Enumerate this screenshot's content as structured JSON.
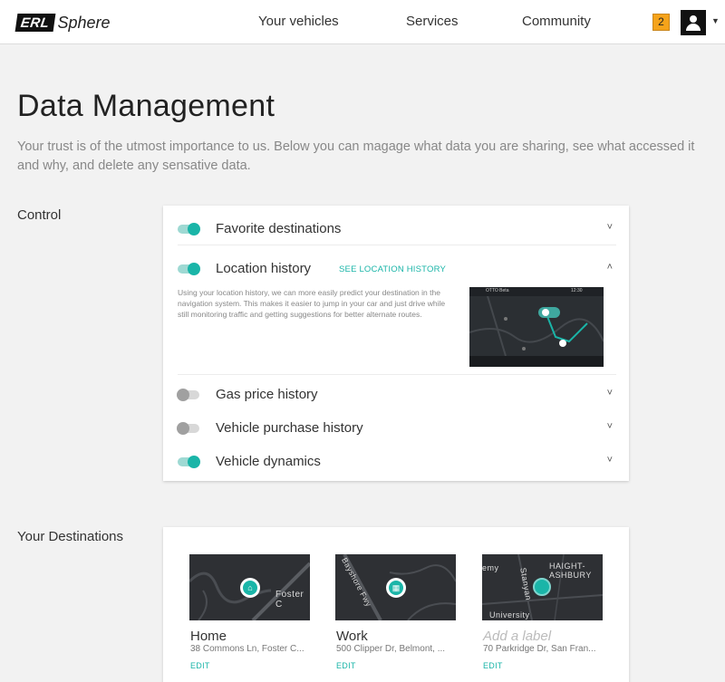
{
  "header": {
    "logo_box": "ERL",
    "logo_word": "Sphere",
    "nav": [
      "Your vehicles",
      "Services",
      "Community"
    ],
    "notification_count": "2"
  },
  "page": {
    "title": "Data Management",
    "description": "Your trust is of the utmost importance to us. Below you can magage what data you are sharing, see what accessed it and why, and delete any sensative data."
  },
  "control": {
    "label": "Control",
    "items": [
      {
        "label": "Favorite destinations",
        "enabled": true,
        "expanded": false
      },
      {
        "label": "Location history",
        "enabled": true,
        "expanded": true,
        "link": "SEE LOCATION HISTORY",
        "detail": "Using your location history, we can more easily predict your destination in the navigation system. This makes it easier to jump in your car and just drive while still monitoring traffic and getting suggestions for better alternate routes."
      },
      {
        "label": "Gas price history",
        "enabled": false,
        "expanded": false
      },
      {
        "label": "Vehicle purchase history",
        "enabled": false,
        "expanded": false
      },
      {
        "label": "Vehicle dynamics",
        "enabled": true,
        "expanded": false
      }
    ],
    "car_screen": {
      "app_name": "OTTO Beta",
      "time": "12:30"
    }
  },
  "destinations": {
    "label": "Your Destinations",
    "items": [
      {
        "name": "Home",
        "address": "38 Commons Ln, Foster C...",
        "edit": "EDIT",
        "map_label": "Foster C",
        "icon": "home-icon"
      },
      {
        "name": "Work",
        "address": "500 Clipper Dr, Belmont, ...",
        "edit": "EDIT",
        "map_label": "Bayshore Fwy",
        "icon": "building-icon"
      },
      {
        "name": "",
        "placeholder": "Add a label",
        "address": "70 Parkridge Dr, San Fran...",
        "edit": "EDIT",
        "map_label": "HAIGHT-ASHBURY",
        "map_label2": "University",
        "map_label3": "Stanyan",
        "map_label4": "emy"
      }
    ]
  },
  "colors": {
    "accent": "#1ab5a8",
    "badge": "#f5a31a"
  }
}
